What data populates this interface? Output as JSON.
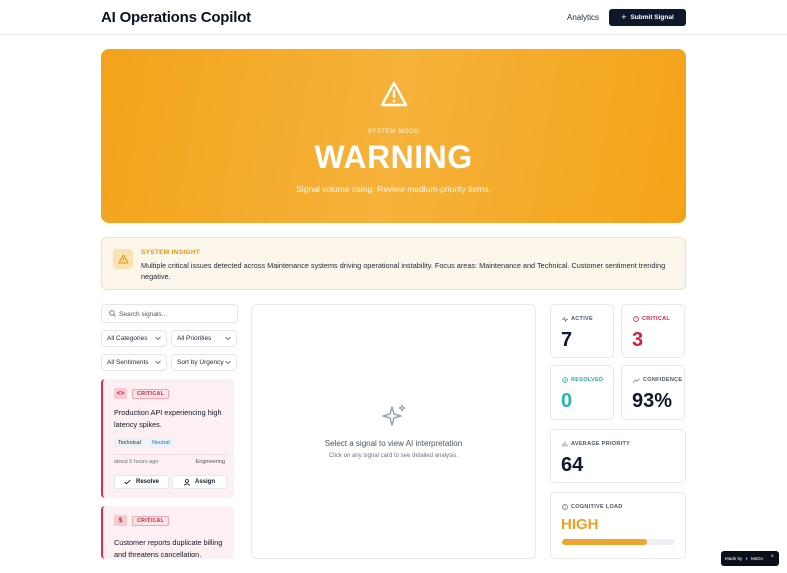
{
  "header": {
    "brand": "AI Operations Copilot",
    "analytics": "Analytics",
    "submit": "Submit Signal"
  },
  "hero": {
    "label": "SYSTEM MOOD",
    "title": "WARNING",
    "subtitle": "Signal volume rising. Review medium-priority items.",
    "icon": "warning-triangle-icon"
  },
  "insight": {
    "label": "SYSTEM INSIGHT",
    "text": "Multiple critical issues detected across Maintenance systems driving operational instability. Focus areas: Maintenance and Technical. Customer sentiment trending negative."
  },
  "filters": {
    "search_placeholder": "Search signals...",
    "categories": "All Categories",
    "priorities": "All Priorities",
    "sentiments": "All Sentiments",
    "sort": "Sort by Urgency"
  },
  "signals": [
    {
      "icon": "<>",
      "badge": "CRITICAL",
      "title": "Production API experiencing high latency spikes.",
      "tags": [
        "Technical",
        "Neutral"
      ],
      "time": "about 5 hours ago",
      "dept": "Engineering",
      "resolve": "Resolve",
      "assign": "Assign"
    },
    {
      "icon": "$",
      "badge": "CRITICAL",
      "title": "Customer reports duplicate billing and threatens cancellation."
    }
  ],
  "detail": {
    "title": "Select a signal to view AI interpretation",
    "subtitle": "Click on any signal card to see detailed analysis."
  },
  "stats": {
    "active": {
      "label": "ACTIVE",
      "value": "7",
      "color": "#0f172a"
    },
    "critical": {
      "label": "CRITICAL",
      "value": "3",
      "color": "#d0203f"
    },
    "resolved": {
      "label": "RESOLVED",
      "value": "0",
      "color": "#27b5a9"
    },
    "confidence": {
      "label": "CONFIDENCE",
      "value": "93%",
      "color": "#0f172a"
    },
    "avg_priority": {
      "label": "AVERAGE PRIORITY",
      "value": "64"
    },
    "cognitive": {
      "label": "COGNITIVE LOAD",
      "value": "HIGH",
      "level": 0.75,
      "color": "#f0a020"
    }
  },
  "footer": {
    "made_by": "Made by",
    "maker": "MeDo"
  }
}
